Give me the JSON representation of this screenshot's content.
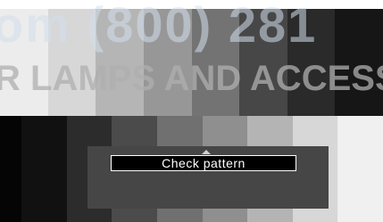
{
  "watermark": {
    "line1": "om (800) 281",
    "line2": "R LAMPS AND ACCESS"
  },
  "pattern": {
    "top_colors": [
      "#ececec",
      "#d7d7d7",
      "#b5b5b5",
      "#979797",
      "#737373",
      "#474747",
      "#2a2a2a",
      "#161616"
    ],
    "bottom_colors": [
      "#050505",
      "#111111",
      "#2c2c2c",
      "#4b4b4b",
      "#707070",
      "#8f8f8f",
      "#b4b4b4",
      "#d7d7d7",
      "#f0f0f0"
    ]
  },
  "menu": {
    "selected_label": "Check pattern",
    "panel_color": "#464646",
    "selected_bg": "#000000",
    "selected_text": "#ffffff",
    "arrow_icon": "triangle-up-icon"
  }
}
